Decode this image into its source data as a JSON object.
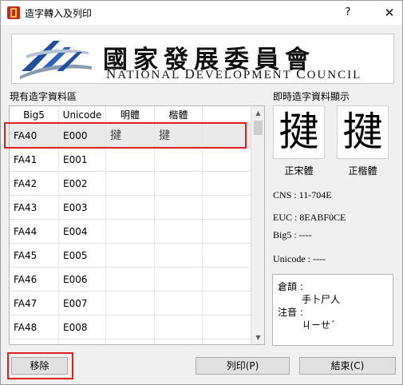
{
  "window": {
    "title": "造字轉入及列印",
    "help_glyph": "?",
    "close_glyph": "✕"
  },
  "banner": {
    "chinese": "國家發展委員會",
    "english_parts": [
      "N",
      "ATIONAL ",
      "D",
      "EVELOPMENT ",
      "C",
      "OUNCIL"
    ]
  },
  "left_panel": {
    "label": "現有造字資料區",
    "headers": [
      "Big5",
      "Unicode",
      "明體",
      "楷體"
    ],
    "rows": [
      {
        "big5": "FA40",
        "unicode": "E000",
        "ming": "揵",
        "kai": "揵"
      },
      {
        "big5": "FA41",
        "unicode": "E001",
        "ming": "",
        "kai": ""
      },
      {
        "big5": "FA42",
        "unicode": "E002",
        "ming": "",
        "kai": ""
      },
      {
        "big5": "FA43",
        "unicode": "E003",
        "ming": "",
        "kai": ""
      },
      {
        "big5": "FA44",
        "unicode": "E004",
        "ming": "",
        "kai": ""
      },
      {
        "big5": "FA45",
        "unicode": "E005",
        "ming": "",
        "kai": ""
      },
      {
        "big5": "FA46",
        "unicode": "E006",
        "ming": "",
        "kai": ""
      },
      {
        "big5": "FA47",
        "unicode": "E007",
        "ming": "",
        "kai": ""
      },
      {
        "big5": "FA48",
        "unicode": "E008",
        "ming": "",
        "kai": ""
      },
      {
        "big5": "",
        "unicode": "",
        "ming": "",
        "kai": ""
      }
    ],
    "selected_row": 0
  },
  "right_panel": {
    "label": "即時造字資料顯示",
    "preview_char": "揵",
    "caption_song": "正宋體",
    "caption_kai": "正楷體",
    "cns": "CNS : 11-704E",
    "euc": "EUC : 8EABF0CE",
    "big5": "Big5 : ----",
    "unicode": "Unicode : ----",
    "cangjie_label": "倉頡 :",
    "cangjie_value": "手卜尸人",
    "zhuyin_label": "注音 :",
    "zhuyin_value": "ㄐㄧㄝˊ"
  },
  "buttons": {
    "remove": "移除",
    "print": "列印(P)",
    "close": "結束(C)"
  },
  "colors": {
    "highlight_outline": "#e02020",
    "logo_blue": "#1f4fa0",
    "logo_gray": "#8a9bb0"
  },
  "icons": {
    "app": "app-icon",
    "scroll_up": "scroll-up-arrow-icon",
    "scroll_down": "scroll-down-arrow-icon",
    "logo": "ndc-logo-icon"
  }
}
